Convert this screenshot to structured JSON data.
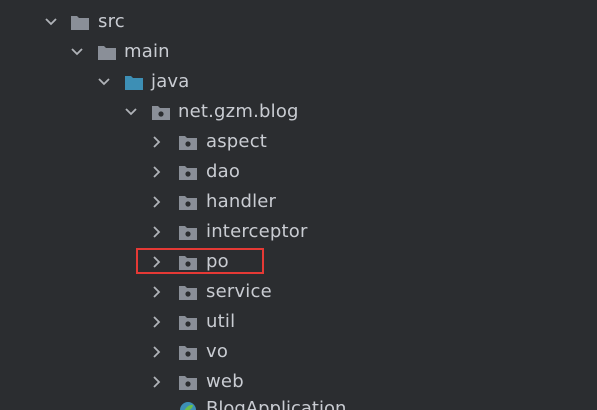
{
  "project_tree": {
    "src": {
      "label": "src",
      "icon": "folder-icon",
      "state": "expanded"
    },
    "main": {
      "label": "main",
      "icon": "folder-icon",
      "state": "expanded"
    },
    "java": {
      "label": "java",
      "icon": "source-root-folder-icon",
      "state": "expanded"
    },
    "package": {
      "label": "net.gzm.blog",
      "icon": "package-icon",
      "state": "expanded"
    },
    "children": [
      {
        "label": "aspect",
        "icon": "package-icon",
        "state": "collapsed"
      },
      {
        "label": "dao",
        "icon": "package-icon",
        "state": "collapsed"
      },
      {
        "label": "handler",
        "icon": "package-icon",
        "state": "collapsed"
      },
      {
        "label": "interceptor",
        "icon": "package-icon",
        "state": "collapsed"
      },
      {
        "label": "po",
        "icon": "package-icon",
        "state": "collapsed",
        "highlighted": true
      },
      {
        "label": "service",
        "icon": "package-icon",
        "state": "collapsed"
      },
      {
        "label": "util",
        "icon": "package-icon",
        "state": "collapsed"
      },
      {
        "label": "vo",
        "icon": "package-icon",
        "state": "collapsed"
      },
      {
        "label": "web",
        "icon": "package-icon",
        "state": "collapsed"
      }
    ],
    "main_class": {
      "label": "BlogApplication",
      "icon": "spring-boot-class-icon"
    }
  },
  "colors": {
    "background": "#2b2d30",
    "text": "#c9ccd2",
    "folder": "#8a8f98",
    "source_root": "#3d8fb5",
    "highlight_border": "#e53935"
  }
}
